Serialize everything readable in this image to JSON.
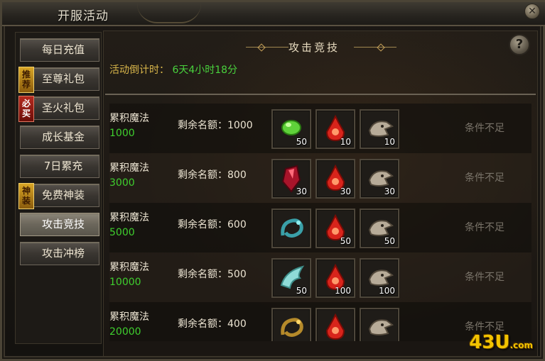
{
  "window": {
    "title": "开服活动",
    "close_icon": "close-icon"
  },
  "sidebar": {
    "items": [
      {
        "label": "每日充值",
        "badge": ""
      },
      {
        "label": "至尊礼包",
        "badge": "推荐",
        "badge_color": "gold"
      },
      {
        "label": "圣火礼包",
        "badge": "必买",
        "badge_color": "red"
      },
      {
        "label": "成长基金",
        "badge": ""
      },
      {
        "label": "7日累充",
        "badge": ""
      },
      {
        "label": "免费神装",
        "badge": "神装",
        "badge_color": "gold"
      },
      {
        "label": "攻击竞技",
        "badge": "",
        "active": true
      },
      {
        "label": "攻击冲榜",
        "badge": ""
      }
    ]
  },
  "main": {
    "section_title": "攻击竞技",
    "help_icon": "?",
    "countdown_label": "活动倒计时：",
    "countdown_value": "6天4小时18分",
    "rows": [
      {
        "title": "累积魔法",
        "amount": "1000",
        "quota": "剩余名额：1000",
        "rewards": [
          {
            "icon": "green-gem-icon",
            "qty": "50"
          },
          {
            "icon": "red-potion-icon",
            "qty": "10"
          },
          {
            "icon": "dragon-skull-icon",
            "qty": "10"
          }
        ],
        "status": "条件不足"
      },
      {
        "title": "累积魔法",
        "amount": "3000",
        "quota": "剩余名额：800",
        "rewards": [
          {
            "icon": "red-crystal-icon",
            "qty": "30"
          },
          {
            "icon": "red-potion-icon",
            "qty": "30"
          },
          {
            "icon": "dragon-skull-icon",
            "qty": "30"
          }
        ],
        "status": "条件不足"
      },
      {
        "title": "累积魔法",
        "amount": "5000",
        "quota": "剩余名额：600",
        "rewards": [
          {
            "icon": "teal-dragon-icon",
            "qty": ""
          },
          {
            "icon": "red-potion-icon",
            "qty": "50"
          },
          {
            "icon": "dragon-skull-icon",
            "qty": "50"
          }
        ],
        "status": "条件不足"
      },
      {
        "title": "累积魔法",
        "amount": "10000",
        "quota": "剩余名额：500",
        "rewards": [
          {
            "icon": "wing-icon",
            "qty": "50"
          },
          {
            "icon": "red-potion-icon",
            "qty": "100"
          },
          {
            "icon": "dragon-skull-icon",
            "qty": "100"
          }
        ],
        "status": "条件不足"
      },
      {
        "title": "累积魔法",
        "amount": "20000",
        "quota": "剩余名额：400",
        "rewards": [
          {
            "icon": "gold-dragon-icon",
            "qty": ""
          },
          {
            "icon": "red-potion-icon",
            "qty": ""
          },
          {
            "icon": "dragon-skull-icon",
            "qty": ""
          }
        ],
        "status": "条件不足"
      }
    ]
  },
  "watermark": {
    "logo": "43U",
    "domain": ".com"
  }
}
